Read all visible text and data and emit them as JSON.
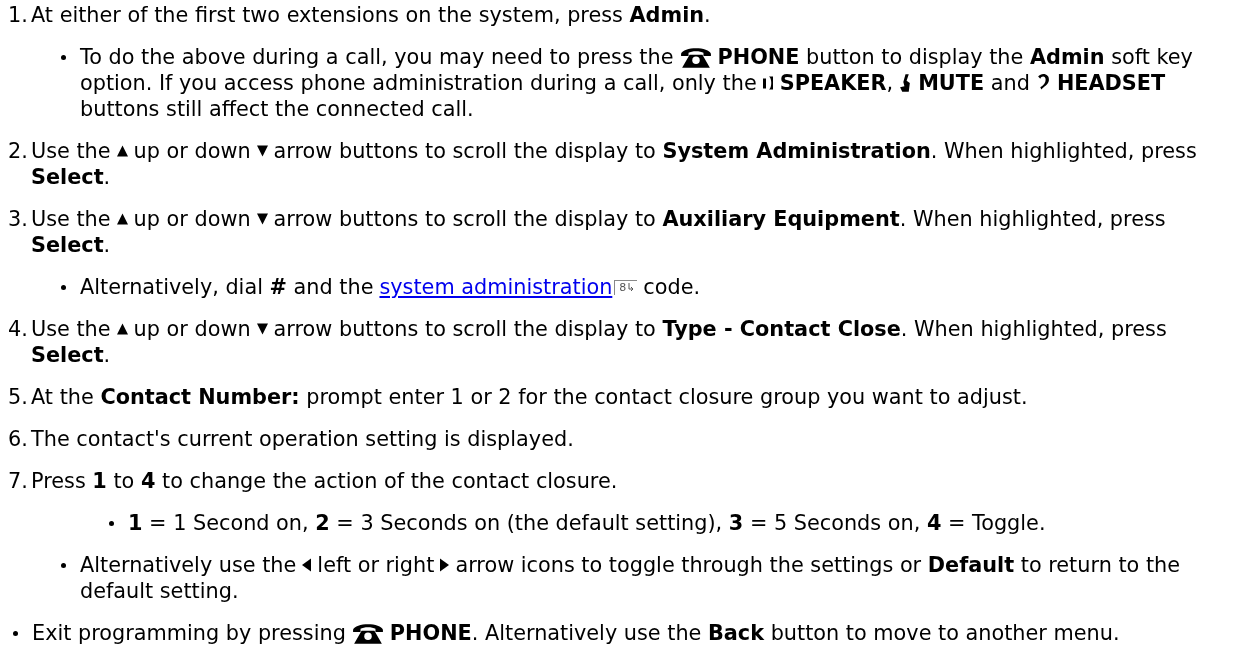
{
  "steps": [
    {
      "number": "1.",
      "lines": [
        [
          {
            "kind": "text",
            "text": "At either of the first two extensions on the system, press **Admin**."
          }
        ]
      ],
      "subitems": [
        {
          "lines": [
            [
              {
                "kind": "text",
                "text": "To do the above during a call, you may need to press the"
              },
              {
                "kind": "phone"
              },
              {
                "kind": "text",
                "text": "**PHONE** button to display the **Admin** soft key"
              }
            ],
            [
              {
                "kind": "text",
                "text": "option. If you access phone administration during a call, only the"
              },
              {
                "kind": "speaker"
              },
              {
                "kind": "text",
                "text": "**SPEAKER**,"
              },
              {
                "kind": "mute"
              },
              {
                "kind": "text",
                "text": "**MUTE** and"
              },
              {
                "kind": "headset"
              },
              {
                "kind": "text",
                "text": "**HEADSET**"
              }
            ],
            [
              {
                "kind": "text",
                "text": "buttons still affect the connected call."
              }
            ]
          ]
        }
      ]
    },
    {
      "number": "2.",
      "lines": [
        [
          {
            "kind": "text",
            "text": "Use the"
          },
          {
            "kind": "up"
          },
          {
            "kind": "text",
            "text": "up or down"
          },
          {
            "kind": "down"
          },
          {
            "kind": "text",
            "text": "arrow buttons to scroll the display to **System Administration**. When highlighted, press"
          }
        ],
        [
          {
            "kind": "text",
            "text": "**Select**."
          }
        ]
      ]
    },
    {
      "number": "3.",
      "lines": [
        [
          {
            "kind": "text",
            "text": "Use the"
          },
          {
            "kind": "up"
          },
          {
            "kind": "text",
            "text": "up or down"
          },
          {
            "kind": "down"
          },
          {
            "kind": "text",
            "text": "arrow buttons to scroll the display to **Auxiliary Equipment**. When highlighted, press"
          }
        ],
        [
          {
            "kind": "text",
            "text": "**Select**."
          }
        ]
      ],
      "subitems": [
        {
          "lines": [
            [
              {
                "kind": "text",
                "text": "Alternatively, dial **#** and the"
              },
              {
                "kind": "link",
                "text": "system administration"
              },
              {
                "kind": "pageref",
                "text": "8"
              },
              {
                "kind": "text",
                "text": "code."
              }
            ]
          ]
        }
      ]
    },
    {
      "number": "4.",
      "lines": [
        [
          {
            "kind": "text",
            "text": "Use the"
          },
          {
            "kind": "up"
          },
          {
            "kind": "text",
            "text": "up or down"
          },
          {
            "kind": "down"
          },
          {
            "kind": "text",
            "text": "arrow buttons to scroll the display to **Type - Contact Close**. When highlighted, press"
          }
        ],
        [
          {
            "kind": "text",
            "text": "**Select**."
          }
        ]
      ]
    },
    {
      "number": "5.",
      "lines": [
        [
          {
            "kind": "text",
            "text": "At the **Contact Number:** prompt enter 1 or 2 for the contact closure group you want to adjust."
          }
        ]
      ]
    },
    {
      "number": "6.",
      "lines": [
        [
          {
            "kind": "text",
            "text": "The contact's current operation setting is displayed."
          }
        ]
      ]
    },
    {
      "number": "7.",
      "lines": [
        [
          {
            "kind": "text",
            "text": "Press **1** to **4** to change the action of the contact closure."
          }
        ]
      ],
      "subitems": [
        {
          "children": [
            {
              "lines": [
                [
                  {
                    "kind": "text",
                    "text": "**1** = 1 Second on, **2** = 3 Seconds on (the default setting), **3** = 5 Seconds on, **4** = Toggle."
                  }
                ]
              ]
            }
          ]
        },
        {
          "lines": [
            [
              {
                "kind": "text",
                "text": "Alternatively use the"
              },
              {
                "kind": "left"
              },
              {
                "kind": "text",
                "text": "left or right"
              },
              {
                "kind": "right"
              },
              {
                "kind": "text",
                "text": "arrow icons to toggle through the settings or **Default** to return to the"
              }
            ],
            [
              {
                "kind": "text",
                "text": "default setting."
              }
            ]
          ]
        }
      ]
    }
  ],
  "notes": [
    {
      "lines": [
        [
          {
            "kind": "text",
            "text": "Exit programming by pressing"
          },
          {
            "kind": "phone"
          },
          {
            "kind": "text",
            "text": "**PHONE**. Alternatively use the **Back** button to move to another menu."
          }
        ]
      ]
    }
  ]
}
